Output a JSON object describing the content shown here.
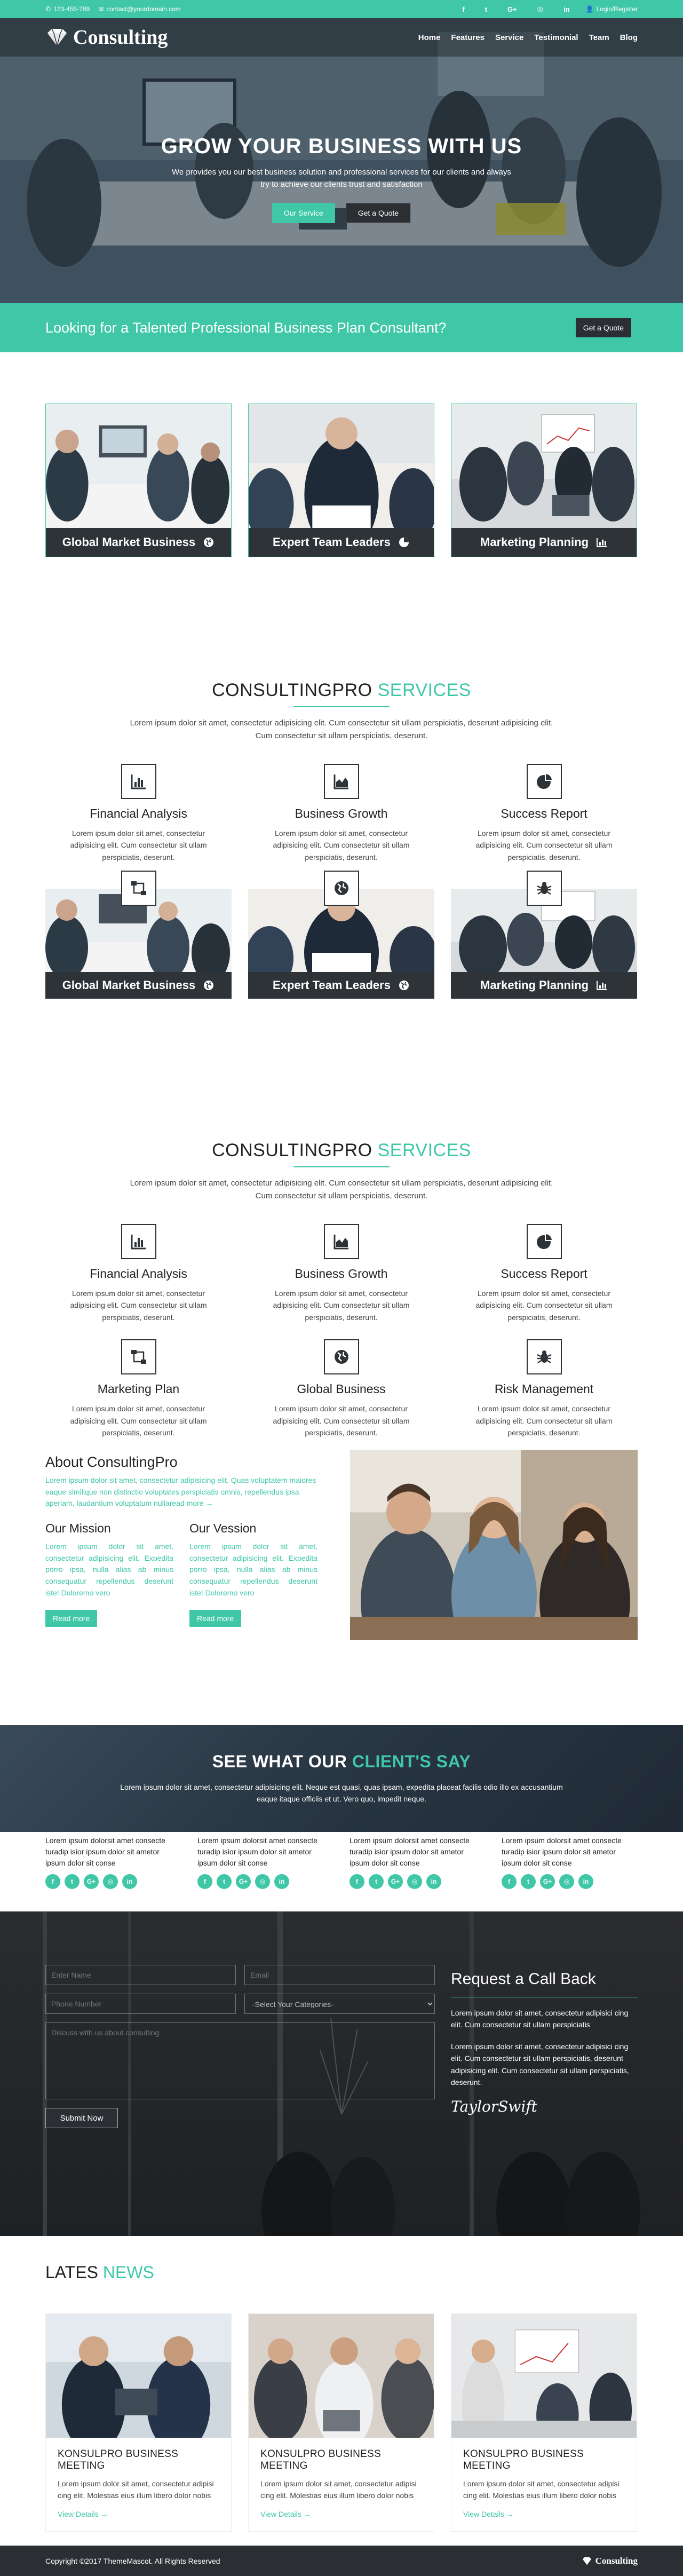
{
  "topbar": {
    "phone": "123-456-789",
    "email": "contact@yourdomain.com",
    "socials": [
      "f",
      "t",
      "G+",
      "◎",
      "in"
    ],
    "login": "Login/Register"
  },
  "nav": {
    "logo": "Consulting",
    "items": [
      "Home",
      "Features",
      "Service",
      "Testimonial",
      "Team",
      "Blog"
    ]
  },
  "hero": {
    "title": "GROW YOUR BUSINESS WITH US",
    "subtitle": "We provides you our best business solution and professional services for our clients and always try to achieve our clients trust and satisfaction",
    "btn_primary": "Our Service",
    "btn_secondary": "Get a Quote"
  },
  "cta": {
    "text": "Looking for a Talented Professional Business Plan Consultant?",
    "button": "Get a Quote"
  },
  "cards": [
    {
      "title": "Global Market Business",
      "icon": "globe-icon"
    },
    {
      "title": "Expert Team Leaders",
      "icon": "pie-chart-icon"
    },
    {
      "title": "Marketing Planning",
      "icon": "bar-chart-icon"
    }
  ],
  "services1": {
    "title_a": "CONSULTINGPRO",
    "title_b": "SERVICES",
    "desc": "Lorem ipsum dolor sit amet, consectetur adipisicing elit. Cum consectetur sit ullam perspiciatis, deserunt adipisicing elit. Cum consectetur sit ullam perspiciatis, deserunt.",
    "items": [
      {
        "title": "Financial Analysis",
        "text": "Lorem ipsum dolor sit amet, consectetur adipisicing elit. Cum consectetur sit ullam perspiciatis, deserunt."
      },
      {
        "title": "Business Growth",
        "text": "Lorem ipsum dolor sit amet, consectetur adipisicing elit. Cum consectetur sit ullam perspiciatis, deserunt."
      },
      {
        "title": "Success Report",
        "text": "Lorem ipsum dolor sit amet, consectetur adipisicing elit. Cum consectetur sit ullam perspiciatis, deserunt."
      }
    ]
  },
  "cards2": [
    {
      "title": "Global Market Business",
      "icon": "globe-icon"
    },
    {
      "title": "Expert Team Leaders",
      "icon": "globe-icon"
    },
    {
      "title": "Marketing Planning",
      "icon": "bar-chart-icon"
    }
  ],
  "services2": {
    "title_a": "CONSULTINGPRO",
    "title_b": "SERVICES",
    "desc": "Lorem ipsum dolor sit amet, consectetur adipisicing elit. Cum consectetur sit ullam perspiciatis, deserunt adipisicing elit. Cum consectetur sit ullam perspiciatis, deserunt.",
    "items": [
      {
        "title": "Financial Analysis",
        "text": "Lorem ipsum dolor sit amet, consectetur adipisicing elit. Cum consectetur sit ullam perspiciatis, deserunt."
      },
      {
        "title": "Business Growth",
        "text": "Lorem ipsum dolor sit amet, consectetur adipisicing elit. Cum consectetur sit ullam perspiciatis, deserunt."
      },
      {
        "title": "Success Report",
        "text": "Lorem ipsum dolor sit amet, consectetur adipisicing elit. Cum consectetur sit ullam perspiciatis, deserunt."
      },
      {
        "title": "Marketing Plan",
        "text": "Lorem ipsum dolor sit amet, consectetur adipisicing elit. Cum consectetur sit ullam perspiciatis, deserunt."
      },
      {
        "title": "Global Business",
        "text": "Lorem ipsum dolor sit amet, consectetur adipisicing elit. Cum consectetur sit ullam perspiciatis, deserunt."
      },
      {
        "title": "Risk Management",
        "text": "Lorem ipsum dolor sit amet, consectetur adipisicing elit. Cum consectetur sit ullam perspiciatis, deserunt."
      }
    ]
  },
  "about": {
    "title": "About ConsultingPro",
    "lead": "Lorem ipsum dolor sit amet, consectetur adipisicing elit. Quas voluptatem maiores eaque similique non distinctio voluptates perspiciatis omnis, repellendus ipsa aperiam, laudantium voluptatum nullaread more →",
    "mission_title": "Our Mission",
    "mission_text": "Lorem ipsum dolor sit amet, consectetur adipisicing elit. Expedita porro ipsa, nulla alias ab minus consequatur repellendus deserunt iste! Doloremo vero",
    "mission_btn": "Read more",
    "vision_title": "Our Vession",
    "vision_text": "Lorem ipsum dolor sit amet, consectetur adipisicing elit. Expedita porro ipsa, nulla alias ab minus consequatur repellendus deserunt iste! Doloremo vero",
    "vision_btn": "Read more"
  },
  "testimonials": {
    "title_a": "SEE WHAT OUR",
    "title_b": "CLIENT'S SAY",
    "desc": "Lorem ipsum dolor sit amet, consectetur adipisicing elit. Neque est quasi, quas ipsam, expedita placeat facilis odio illo ex accusantium eaque itaque officiis et ut. Vero quo, impedit neque.",
    "items": [
      {
        "text": "Lorem ipsum dolorsit amet consecte turadip isior ipsum dolor sit ametor ipsum dolor sit conse"
      },
      {
        "text": "Lorem ipsum dolorsit amet consecte turadip isior ipsum dolor sit ametor ipsum dolor sit conse"
      },
      {
        "text": "Lorem ipsum dolorsit amet consecte turadip isior ipsum dolor sit ametor ipsum dolor sit conse"
      },
      {
        "text": "Lorem ipsum dolorsit amet consecte turadip isior ipsum dolor sit ametor ipsum dolor sit conse"
      }
    ],
    "socials": [
      "f",
      "t",
      "G+",
      "◎",
      "in"
    ]
  },
  "callback": {
    "name_placeholder": "Enter Name",
    "email_placeholder": "Email",
    "phone_placeholder": "Phone Number",
    "category_selected": "-Select Your Categories-",
    "message_placeholder": "Discuss with us about consulting",
    "submit": "Submit Now",
    "title": "Request a Call Back",
    "p1": "Lorem ipsum dolor sit amet, consectetur adipisici cing elit. Cum consectetur sit ullam perspiciatis",
    "p2": "Lorem ipsum dolor sit amet, consectetur adipisici cing elit. Cum consectetur sit ullam perspiciatis, deserunt adipisicing elit. Cum consectetur sit ullam perspiciatis, deserunt.",
    "signature": "TaylorSwift"
  },
  "news": {
    "title_a": "LATES",
    "title_b": "NEWS",
    "items": [
      {
        "title": "KONSULPRO BUSINESS MEETING",
        "text": "Lorem ipsum dolor sit amet, consectetur adipisi cing elit. Molestias eius illum libero dolor nobis",
        "link": "View Details →"
      },
      {
        "title": "KONSULPRO BUSINESS MEETING",
        "text": "Lorem ipsum dolor sit amet, consectetur adipisi cing elit. Molestias eius illum libero dolor nobis",
        "link": "View Details →"
      },
      {
        "title": "KONSULPRO BUSINESS MEETING",
        "text": "Lorem ipsum dolor sit amet, consectetur adipisi cing elit. Molestias eius illum libero dolor nobis",
        "link": "View Details →"
      }
    ]
  },
  "footer": {
    "copyright": "Copyright ©2017 ThemeMascot. All Rights Reserved",
    "logo": "Consulting"
  },
  "colors": {
    "accent": "#3fc7a8",
    "dark": "#2e3338"
  }
}
